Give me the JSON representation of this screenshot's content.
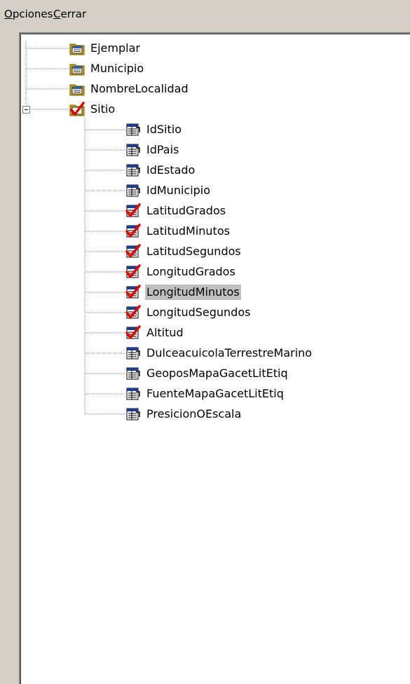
{
  "menu": {
    "opciones": {
      "accel": "O",
      "rest": "pciones"
    },
    "cerrar": {
      "accel": "C",
      "rest": "errar"
    }
  },
  "tree": {
    "roots": [
      {
        "label": "Ejemplar",
        "icon": "table-icon",
        "checked": false
      },
      {
        "label": "Municipio",
        "icon": "table-icon",
        "checked": false
      },
      {
        "label": "NombreLocalidad",
        "icon": "table-icon",
        "checked": false
      },
      {
        "label": "Sitio",
        "icon": "checked-table-icon",
        "checked": true,
        "expanded": true
      }
    ],
    "sitio_fields": [
      {
        "label": "IdSitio",
        "checked": false
      },
      {
        "label": "IdPais",
        "checked": false
      },
      {
        "label": "IdEstado",
        "checked": false
      },
      {
        "label": "IdMunicipio",
        "checked": false
      },
      {
        "label": "LatitudGrados",
        "checked": true
      },
      {
        "label": "LatitudMinutos",
        "checked": true
      },
      {
        "label": "LatitudSegundos",
        "checked": true
      },
      {
        "label": "LongitudGrados",
        "checked": true
      },
      {
        "label": "LongitudMinutos",
        "checked": true,
        "selected": true
      },
      {
        "label": "LongitudSegundos",
        "checked": true
      },
      {
        "label": "Altitud",
        "checked": true
      },
      {
        "label": "DulceacuicolaTerrestreMarino",
        "checked": false
      },
      {
        "label": "GeoposMapaGacetLitEtiq",
        "checked": false
      },
      {
        "label": "FuenteMapaGacetLitEtiq",
        "checked": false
      },
      {
        "label": "PresicionOEscala",
        "checked": false
      }
    ]
  },
  "colors": {
    "background": "#d4d0c8",
    "panel": "#ffffff",
    "selection": "#c0c0c0",
    "check": "#e00000"
  }
}
